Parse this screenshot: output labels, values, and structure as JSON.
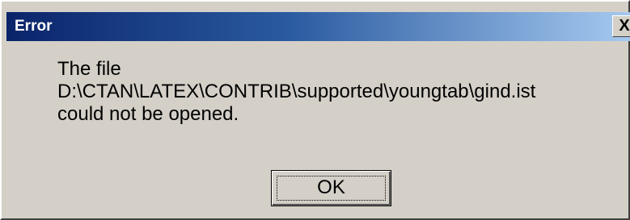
{
  "dialog": {
    "title": "Error",
    "close_glyph": "✕",
    "message_lines": [
      "The file",
      "D:\\CTAN\\LATEX\\CONTRIB\\supported\\youngtab\\gind.ist",
      "could not be opened."
    ],
    "ok_label": "OK"
  },
  "colors": {
    "title_gradient_start": "#0a246a",
    "title_gradient_end": "#a6caf0",
    "face": "#d4d0c8"
  }
}
